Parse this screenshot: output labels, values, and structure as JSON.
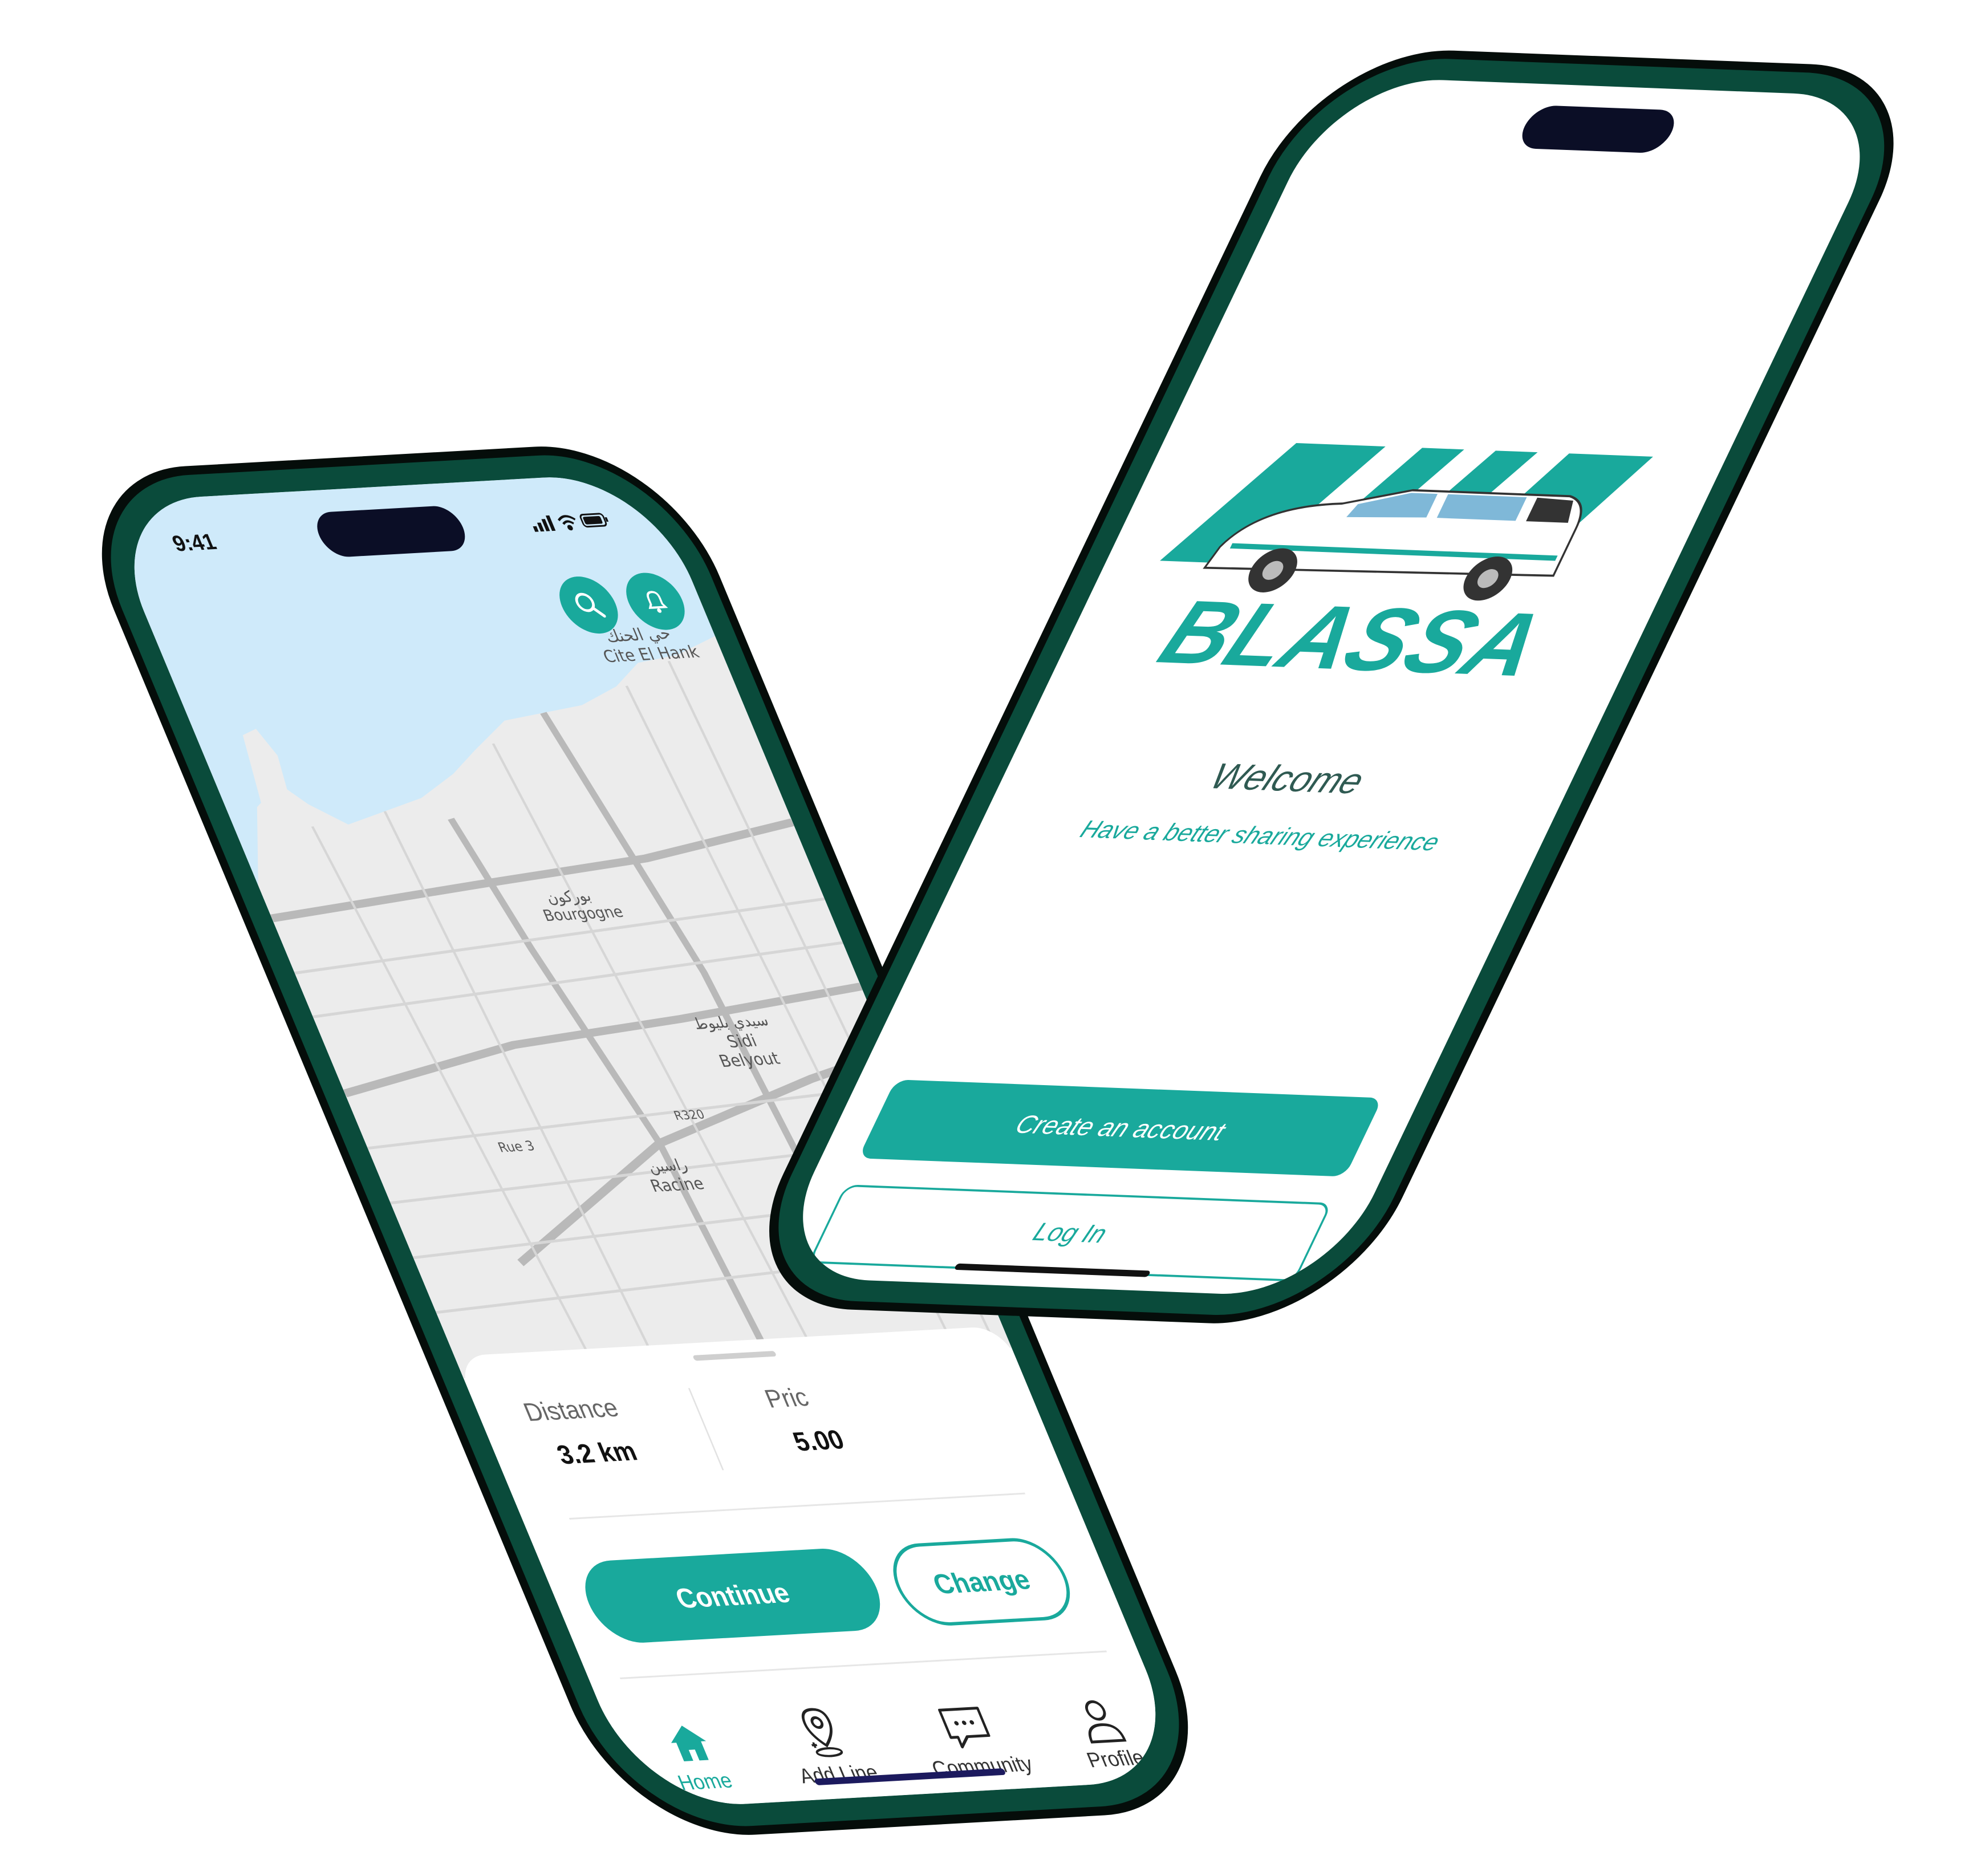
{
  "map_phone": {
    "status": {
      "time": "9:41"
    },
    "map_labels": {
      "cite_el_hank_ar": "حي الحنك",
      "cite_el_hank": "Cite El Hank",
      "bourgogne_ar": "بوركون",
      "bourgogne": "Bourgogne",
      "sidi_belyout_ar": "سيدي بليوط",
      "sidi_belyout_1": "Sidi",
      "sidi_belyout_2": "Belyout",
      "racine_ar": "راسين",
      "racine": "Racine",
      "rue3": "Rue 3",
      "r320": "R320"
    },
    "trip": {
      "distance_label": "Distance",
      "distance_value": "3.2 km",
      "price_label": "Pric",
      "price_value": "5.00"
    },
    "buttons": {
      "continue": "Continue",
      "change": "Change"
    },
    "nav": [
      {
        "label": "Home",
        "icon": "home-icon",
        "active": true
      },
      {
        "label": "Add Line",
        "icon": "add-location-icon",
        "active": false
      },
      {
        "label": "Community",
        "icon": "chat-bubble-icon",
        "active": false
      },
      {
        "label": "Profile",
        "icon": "user-icon",
        "active": false
      }
    ]
  },
  "welcome_phone": {
    "logo_text": "BLASSA",
    "welcome": "Welcome",
    "tagline": "Have a better sharing experience",
    "create_account": "Create an account",
    "login": "Log In"
  },
  "colors": {
    "accent": "#19a99c",
    "frame": "#0a4b3b",
    "sea": "#cfeafa",
    "land": "#ececec"
  }
}
